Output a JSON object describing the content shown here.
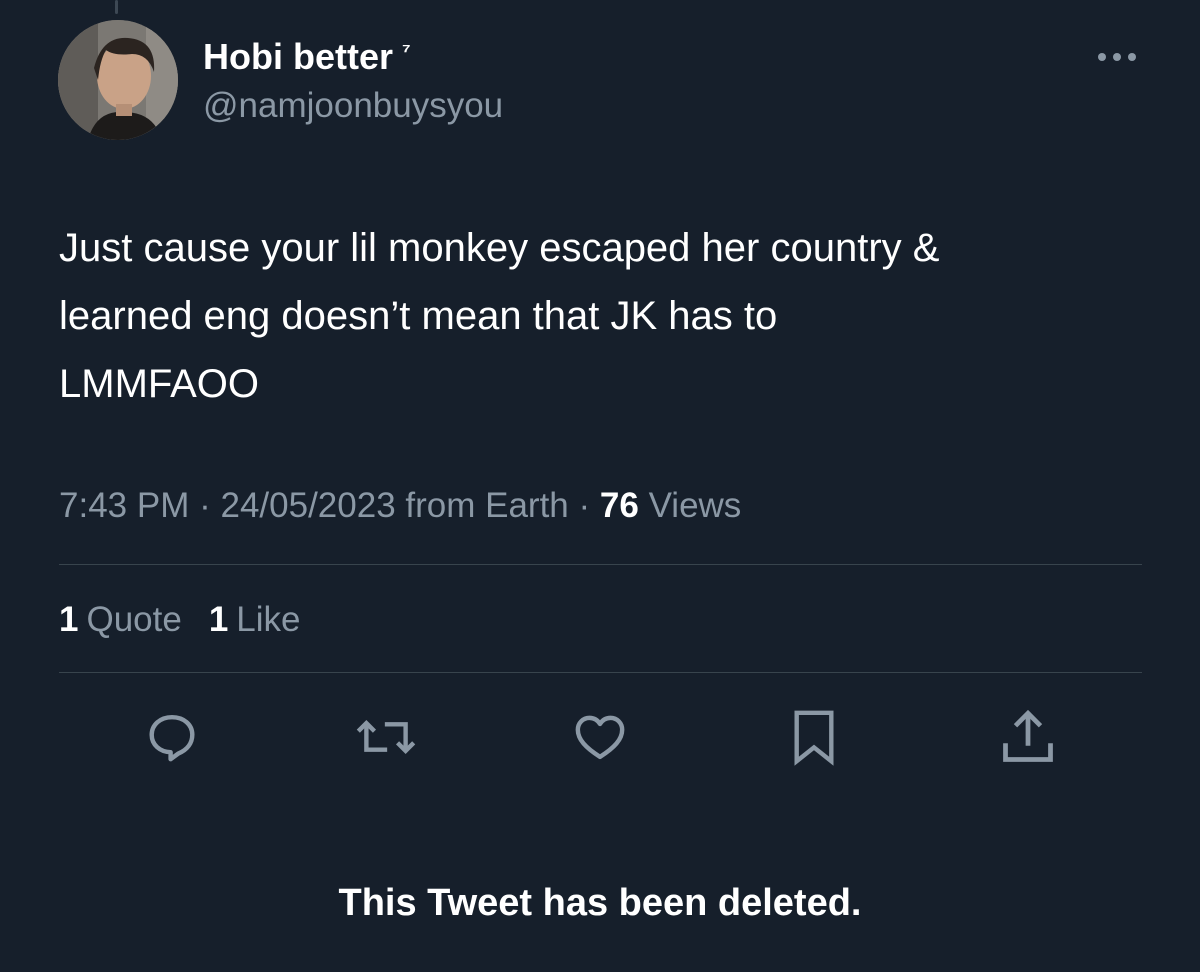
{
  "author": {
    "display_name": "Hobi better",
    "name_suffix": "⁷",
    "handle": "@namjoonbuysyou",
    "avatar_icon": "avatar-photo"
  },
  "tweet": {
    "text": "Just cause your lil monkey escaped her country &\nlearned eng doesn’t mean that JK has to\nLMMFAOO"
  },
  "meta": {
    "time": "7:43 PM",
    "separator": "·",
    "date": "24/05/2023",
    "source": "from Earth",
    "views_count": "76",
    "views_label": "Views"
  },
  "stats": {
    "quotes_count": "1",
    "quotes_label": "Quote",
    "likes_count": "1",
    "likes_label": "Like"
  },
  "actions": {
    "icons": [
      "reply-icon",
      "retweet-icon",
      "like-icon",
      "bookmark-icon",
      "share-icon"
    ]
  },
  "status": {
    "deleted_message": "This Tweet has been deleted."
  },
  "colors": {
    "background": "#161f2b",
    "primary_text": "#ffffff",
    "secondary_text": "#8b98a5",
    "divider": "#38444d"
  }
}
